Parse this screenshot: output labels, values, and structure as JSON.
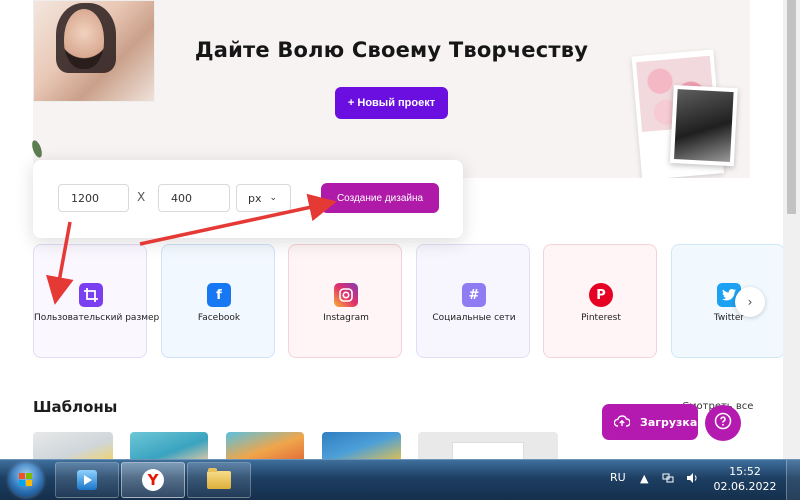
{
  "hero": {
    "title": "Дайте Волю Своему Творчеству",
    "new_project": "+ Новый проект"
  },
  "size_popup": {
    "width_value": "1200",
    "height_value": "400",
    "separator": "X",
    "unit": "px",
    "create_button": "Создание дизайна"
  },
  "categories": [
    {
      "label": "Пользовательский размер",
      "icon": "crop-icon",
      "color": "#7b3ff2"
    },
    {
      "label": "Facebook",
      "icon": "facebook-icon",
      "color": "#1877f2"
    },
    {
      "label": "Instagram",
      "icon": "instagram-icon",
      "color": "#d6249f"
    },
    {
      "label": "Социальные сети",
      "icon": "hashtag-icon",
      "color": "#8f7cf2"
    },
    {
      "label": "Pinterest",
      "icon": "pinterest-icon",
      "color": "#e60023"
    },
    {
      "label": "Twitter",
      "icon": "twitter-icon",
      "color": "#1da1f2"
    }
  ],
  "templates": {
    "title": "Шаблоны",
    "see_all": "Смотреть все"
  },
  "floating": {
    "upload": "Загрузка"
  },
  "taskbar": {
    "language": "RU",
    "time": "15:52",
    "date": "02.06.2022"
  }
}
